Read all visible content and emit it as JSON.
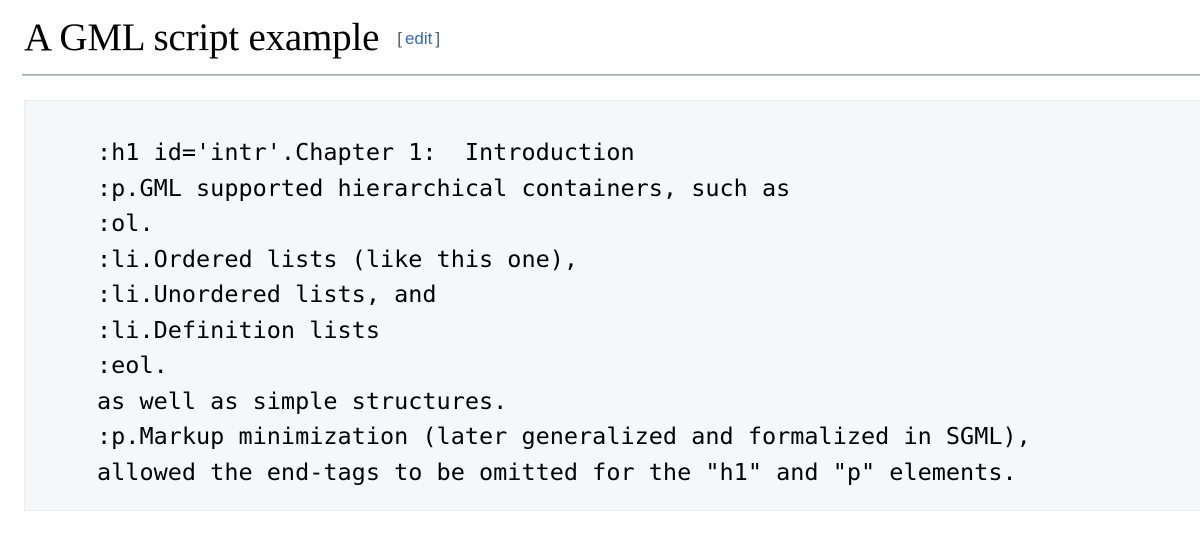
{
  "heading": {
    "title": "A GML script example",
    "edit_open_bracket": "[",
    "edit_label": "edit",
    "edit_close_bracket": "]"
  },
  "colors": {
    "link": "#3366cc",
    "bracket": "#54595d",
    "code_background": "#f6f7f9",
    "code_border": "#eaecf0",
    "rule": "#a2a9b1",
    "text": "#000000"
  },
  "code_block": {
    "language": "gml",
    "lines": [
      ":h1 id='intr'.Chapter 1:  Introduction",
      ":p.GML supported hierarchical containers, such as",
      ":ol.",
      ":li.Ordered lists (like this one),",
      ":li.Unordered lists, and",
      ":li.Definition lists",
      ":eol.",
      "as well as simple structures.",
      ":p.Markup minimization (later generalized and formalized in SGML),",
      "allowed the end-tags to be omitted for the \"h1\" and \"p\" elements."
    ]
  }
}
